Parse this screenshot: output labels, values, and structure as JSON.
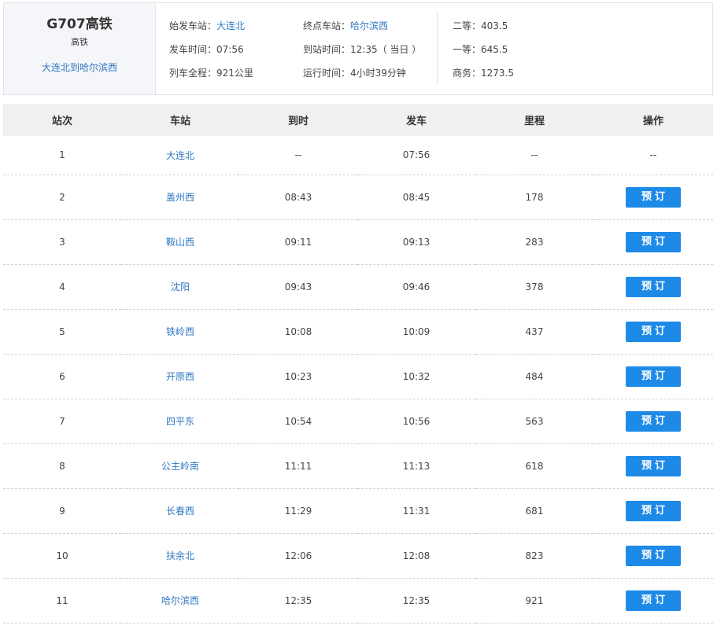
{
  "train": {
    "number": "G707高铁",
    "type": "高铁",
    "route_link": "大连北到哈尔滨西"
  },
  "info": {
    "start_label": "始发车站：",
    "start_value": "大连北",
    "end_label": "终点车站：",
    "end_value": "哈尔滨西",
    "depart_label": "发车时间：",
    "depart_value": "07:56",
    "arrive_label": "到站时间：",
    "arrive_value": "12:35（ 当日 ）",
    "distance_label": "列车全程：",
    "distance_value": "921公里",
    "duration_label": "运行时间：",
    "duration_value": "4小时39分钟"
  },
  "prices": {
    "second_label": "二等：",
    "second_value": "403.5",
    "first_label": "一等：",
    "first_value": "645.5",
    "business_label": "商务：",
    "business_value": "1273.5"
  },
  "table": {
    "headers": [
      "站次",
      "车站",
      "到时",
      "发车",
      "里程",
      "操作"
    ],
    "book_label": "预订",
    "rows": [
      {
        "no": "1",
        "station": "大连北",
        "arrive": "--",
        "depart": "07:56",
        "km": "--",
        "action": "--"
      },
      {
        "no": "2",
        "station": "盖州西",
        "arrive": "08:43",
        "depart": "08:45",
        "km": "178"
      },
      {
        "no": "3",
        "station": "鞍山西",
        "arrive": "09:11",
        "depart": "09:13",
        "km": "283"
      },
      {
        "no": "4",
        "station": "沈阳",
        "arrive": "09:43",
        "depart": "09:46",
        "km": "378"
      },
      {
        "no": "5",
        "station": "铁岭西",
        "arrive": "10:08",
        "depart": "10:09",
        "km": "437"
      },
      {
        "no": "6",
        "station": "开原西",
        "arrive": "10:23",
        "depart": "10:32",
        "km": "484"
      },
      {
        "no": "7",
        "station": "四平东",
        "arrive": "10:54",
        "depart": "10:56",
        "km": "563"
      },
      {
        "no": "8",
        "station": "公主岭南",
        "arrive": "11:11",
        "depart": "11:13",
        "km": "618"
      },
      {
        "no": "9",
        "station": "长春西",
        "arrive": "11:29",
        "depart": "11:31",
        "km": "681"
      },
      {
        "no": "10",
        "station": "扶余北",
        "arrive": "12:06",
        "depart": "12:08",
        "km": "823"
      },
      {
        "no": "11",
        "station": "哈尔滨西",
        "arrive": "12:35",
        "depart": "12:35",
        "km": "921"
      }
    ]
  },
  "colors": {
    "link": "#2f78c2",
    "button": "#1d8ae8",
    "header_bg": "#f0f0f0",
    "train_box_bg": "#f4f6f9"
  }
}
